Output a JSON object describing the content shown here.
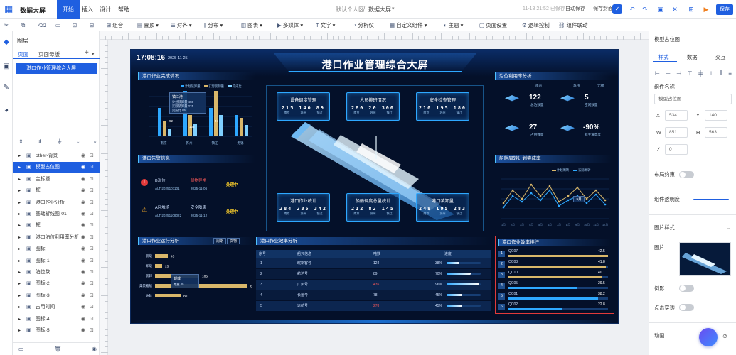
{
  "app": {
    "name": "数据大屏",
    "menus": [
      "开始",
      "插入",
      "设计",
      "帮助"
    ],
    "active_menu": "开始",
    "breadcrumb_space": "默认个人区",
    "breadcrumb_sep": "/",
    "breadcrumb_page": "数据大屏",
    "save_status": "11-18 21:52 已保存",
    "autosave_label": "自动保存",
    "save_cover_label": "保存封面",
    "save_button": "保存"
  },
  "toolbar": [
    "组合",
    "置顶",
    "对齐",
    "分布",
    "图表",
    "多媒体",
    "文字",
    "分析仪",
    "自定义组件",
    "主题",
    "页面设置",
    "逻辑控制",
    "组件联动"
  ],
  "layers": {
    "title": "图层",
    "tab_pages": "页面",
    "tab_master": "页面母版",
    "add": "+",
    "active_page": "港口作业管理综合大屏",
    "items": [
      {
        "name": "other-背景",
        "indent": 1
      },
      {
        "name": "模型占位图",
        "indent": 1,
        "selected": true
      },
      {
        "name": "主标题",
        "indent": 1
      },
      {
        "name": "框",
        "indent": 1
      },
      {
        "name": "港口作业分析",
        "indent": 1
      },
      {
        "name": "基础折线图-01",
        "indent": 1
      },
      {
        "name": "框",
        "indent": 1
      },
      {
        "name": "港口泊位利用率分析",
        "indent": 1
      },
      {
        "name": "图标",
        "indent": 1
      },
      {
        "name": "图标-1",
        "indent": 1
      },
      {
        "name": "泊位数",
        "indent": 1
      },
      {
        "name": "图标-2",
        "indent": 1
      },
      {
        "name": "图标-3",
        "indent": 1
      },
      {
        "name": "占用时间",
        "indent": 1
      },
      {
        "name": "图标-4",
        "indent": 1
      },
      {
        "name": "图标-5",
        "indent": 1
      }
    ]
  },
  "screen": {
    "time": "17:08:16",
    "date": "2025-11-25",
    "title": "港口作业管理综合大屏",
    "p1": {
      "title": "港口作业完成情况",
      "legend": [
        "计划装卸量",
        "实际装卸量",
        "完成比"
      ],
      "tooltip": {
        "title": "镇江港",
        "rows": [
          "计划装卸量 455",
          "实际装卸量 231",
          "完成比 85"
        ]
      },
      "cats": [
        "南京",
        "苏州",
        "镇江",
        "无锡"
      ],
      "labels": [
        "92",
        "133",
        "47"
      ]
    },
    "p2": {
      "title": "港口告警信息",
      "alerts": [
        {
          "code": "B泊位",
          "id": "ALT-2025101101",
          "type": "货物异常",
          "date": "2025-11-06",
          "status": "处理中"
        },
        {
          "code": "A区堆场",
          "id": "ALT-20251108022",
          "type": "安全隐患",
          "date": "2025-11-12",
          "status": "处理中"
        }
      ]
    },
    "c1": {
      "title": "设备调度管理",
      "v": [
        "215",
        "140",
        "89"
      ],
      "s": [
        "南京",
        "苏州",
        "镇江"
      ]
    },
    "c2": {
      "title": "人员排班情况",
      "v": [
        "280",
        "20",
        "300"
      ],
      "s": [
        "南京",
        "苏州",
        "镇江"
      ]
    },
    "c3": {
      "title": "安全检查管理",
      "v": [
        "210",
        "195",
        "180"
      ],
      "s": [
        "南京",
        "苏州",
        "镇江"
      ]
    },
    "c4": {
      "title": "港口作业统计",
      "v": [
        "284",
        "235",
        "342"
      ],
      "s": [
        "南京",
        "苏州",
        "镇江"
      ]
    },
    "c5": {
      "title": "船舶调度总量统计",
      "v": [
        "212",
        "82",
        "145"
      ],
      "s": [
        "南京",
        "苏州",
        "镇江"
      ]
    },
    "c6": {
      "title": "港口装卸量",
      "v": [
        "248",
        "195",
        "283"
      ],
      "s": [
        "南京",
        "苏州",
        "镇江"
      ]
    },
    "p3": {
      "title": "泊位利用率分析",
      "cities": [
        "南京",
        "苏州",
        "无锡"
      ],
      "k1": "122",
      "k1l": "总泊数量",
      "k2": "5",
      "k2l": "空闲数量",
      "k3": "27",
      "k3l": "占用数量",
      "k4": "-90%",
      "k4l": "船主满意度"
    },
    "p4": {
      "title": "船舶周转计划完成率",
      "legend": [
        "计划周转",
        "实际周转"
      ],
      "tooltip": "9月"
    },
    "p5": {
      "title": "港口作业运行分析",
      "tabs": [
        "周期",
        "货物"
      ],
      "rows": [
        {
          "n": "装载",
          "v": "45"
        },
        {
          "n": "卸载",
          "v": "25"
        },
        {
          "n": "装卸",
          "v": "185"
        },
        {
          "n": "集装箱船",
          "v": "6"
        },
        {
          "n": "油轮",
          "v": "80"
        }
      ],
      "tooltip": {
        "title": "卸载",
        "row": "数量 25"
      }
    },
    "p6": {
      "title": "港口作业效率分析",
      "cols": [
        "序号",
        "船只信息",
        "吨数",
        "进度"
      ],
      "rows": [
        {
          "i": "1",
          "s": "皖新客号",
          "t": "124",
          "p": "38%"
        },
        {
          "i": "2",
          "s": "航达号",
          "t": "89",
          "p": "70%"
        },
        {
          "i": "3",
          "s": "广州号",
          "t": "435",
          "p": "96%"
        },
        {
          "i": "4",
          "s": "长运号",
          "t": "78",
          "p": "45%"
        },
        {
          "i": "5",
          "s": "远航号",
          "t": "278",
          "p": "45%"
        }
      ]
    },
    "p7": {
      "title": "港口作业效率排行",
      "rows": [
        {
          "i": "1",
          "n": "QC07",
          "v": "42.5"
        },
        {
          "i": "2",
          "n": "QC03",
          "v": "41.8"
        },
        {
          "i": "3",
          "n": "QC10",
          "v": "40.1"
        },
        {
          "i": "4",
          "n": "QC05",
          "v": "29.5"
        },
        {
          "i": "5",
          "n": "QC01",
          "v": "38.2"
        },
        {
          "i": "6",
          "n": "QC02",
          "v": "22.8"
        }
      ]
    }
  },
  "props": {
    "title": "模型占位图",
    "tabs": [
      "样式",
      "数据",
      "交互"
    ],
    "name_label": "组件名称",
    "name_value": "模型占位图",
    "x_label": "X",
    "x": "534",
    "y_label": "Y",
    "y": "140",
    "w_label": "W",
    "w": "851",
    "h_label": "H",
    "h": "563",
    "angle_label": "∠",
    "angle": "0",
    "layout_label": "布局约束",
    "opacity_label": "组件透明度",
    "img_style_label": "图片样式",
    "img_label": "图片",
    "shadow_label": "倒影",
    "click_label": "点击穿透",
    "anim_label": "动画"
  }
}
